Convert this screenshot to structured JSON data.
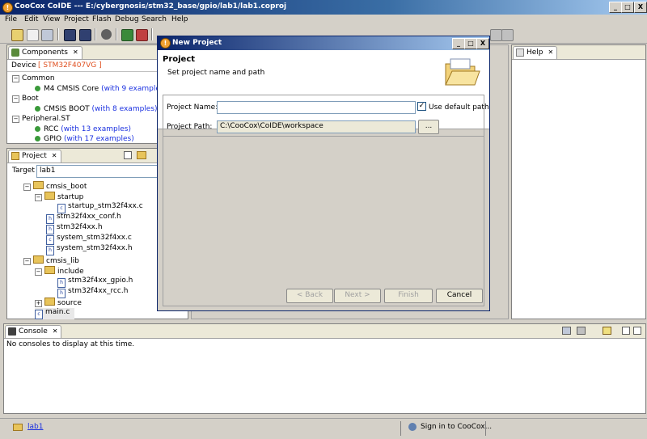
{
  "window": {
    "title": "CooCox CoIDE --- E:/cybergnosis/stm32_base/gpio/lab1/lab1.coproj",
    "controls": {
      "minimize": "_",
      "maximize": "□",
      "close": "X"
    }
  },
  "menu": [
    "File",
    "Edit",
    "View",
    "Project",
    "Flash",
    "Debug",
    "Search",
    "Help"
  ],
  "components_panel": {
    "tab_label": "Components",
    "device_label": "Device",
    "device_value": "[ STM32F407VG ]",
    "groups": [
      {
        "name": "Common",
        "items": [
          {
            "name": "M4 CMSIS Core",
            "examples": "(with 9 examples)"
          }
        ]
      },
      {
        "name": "Boot",
        "items": [
          {
            "name": "CMSIS BOOT",
            "examples": "(with 8 examples)"
          }
        ]
      },
      {
        "name": "Peripheral.ST",
        "items": [
          {
            "name": "RCC",
            "examples": "(with 13 examples)"
          },
          {
            "name": "GPIO",
            "examples": "(with 17 examples)"
          }
        ]
      }
    ]
  },
  "project_panel": {
    "tab_label": "Project",
    "target_label": "Target",
    "target_value": "lab1",
    "tree": {
      "cmsis_boot": "cmsis_boot",
      "startup": "startup",
      "startup_file": "startup_stm32f4xx.c",
      "conf_h": "stm32f4xx_conf.h",
      "f4xx_h": "stm32f4xx.h",
      "system_c": "system_stm32f4xx.c",
      "system_h": "system_stm32f4xx.h",
      "cmsis_lib": "cmsis_lib",
      "include": "include",
      "gpio_h": "stm32f4xx_gpio.h",
      "rcc_h": "stm32f4xx_rcc.h",
      "source": "source",
      "main_c": "main.c"
    }
  },
  "help_panel": {
    "tab_label": "Help"
  },
  "dialog": {
    "title": "New Project",
    "heading": "Project",
    "subheading": "Set project name and path",
    "name_label": "Project Name:",
    "name_value": "",
    "use_default_label": "Use default path",
    "use_default_checked": true,
    "path_label": "Project Path:",
    "path_value": "C:\\CooCox\\CoIDE\\workspace",
    "browse_label": "...",
    "back_label": "< Back",
    "next_label": "Next >",
    "finish_label": "Finish",
    "cancel_label": "Cancel"
  },
  "console_panel": {
    "tab_label": "Console",
    "message": "No consoles to display at this time."
  },
  "statusbar": {
    "project_link": "lab1",
    "signin": "Sign in to CooCox..."
  }
}
